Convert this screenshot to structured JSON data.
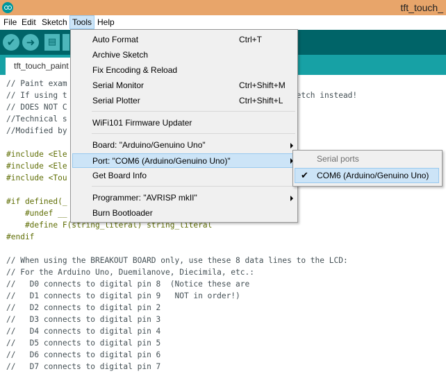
{
  "window": {
    "title": "tft_touch_"
  },
  "menubar": [
    {
      "label": "File"
    },
    {
      "label": "Edit"
    },
    {
      "label": "Sketch"
    },
    {
      "label": "Tools"
    },
    {
      "label": "Help"
    }
  ],
  "toolbar": {
    "verify_glyph": "✔",
    "upload_glyph": "➜",
    "new_glyph": "▤"
  },
  "tab": {
    "label": "tft_touch_paint"
  },
  "tools_menu": {
    "items": [
      {
        "label": "Auto Format",
        "shortcut": "Ctrl+T"
      },
      {
        "label": "Archive Sketch",
        "shortcut": ""
      },
      {
        "label": "Fix Encoding & Reload",
        "shortcut": ""
      },
      {
        "label": "Serial Monitor",
        "shortcut": "Ctrl+Shift+M"
      },
      {
        "label": "Serial Plotter",
        "shortcut": "Ctrl+Shift+L"
      },
      {
        "label": "WiFi101 Firmware Updater",
        "shortcut": ""
      },
      {
        "label": "Board: \"Arduino/Genuino Uno\"",
        "shortcut": ""
      },
      {
        "label": "Port: \"COM6 (Arduino/Genuino Uno)\"",
        "shortcut": ""
      },
      {
        "label": "Get Board Info",
        "shortcut": ""
      },
      {
        "label": "Programmer: \"AVRISP mkII\"",
        "shortcut": ""
      },
      {
        "label": "Burn Bootloader",
        "shortcut": ""
      }
    ]
  },
  "port_submenu": {
    "header": "Serial ports",
    "selected_port": "COM6 (Arduino/Genuino Uno)",
    "check_glyph": "✔"
  },
  "code": {
    "lines": [
      "// Paint exam",
      "// If using t                                               sketch instead!",
      "// DOES NOT C",
      "//Technical s",
      "//Modified by",
      "",
      "#include <Ele",
      "#include <Ele",
      "#include <Tou",
      "",
      "#if defined(_",
      "    #undef __",
      "    #define F(string_literal) string_literal",
      "#endif",
      "",
      "// When using the BREAKOUT BOARD only, use these 8 data lines to the LCD:",
      "// For the Arduino Uno, Duemilanove, Diecimila, etc.:",
      "//   D0 connects to digital pin 8  (Notice these are",
      "//   D1 connects to digital pin 9   NOT in order!)",
      "//   D2 connects to digital pin 2",
      "//   D3 connects to digital pin 3",
      "//   D4 connects to digital pin 4",
      "//   D5 connects to digital pin 5",
      "//   D6 connects to digital pin 6",
      "//   D7 connects to digital pin 7"
    ]
  },
  "colors": {
    "titlebar": "#e8a56a",
    "toolbar": "#006468",
    "tabbar": "#17a1a5",
    "menu_highlight": "#cce4f7"
  }
}
